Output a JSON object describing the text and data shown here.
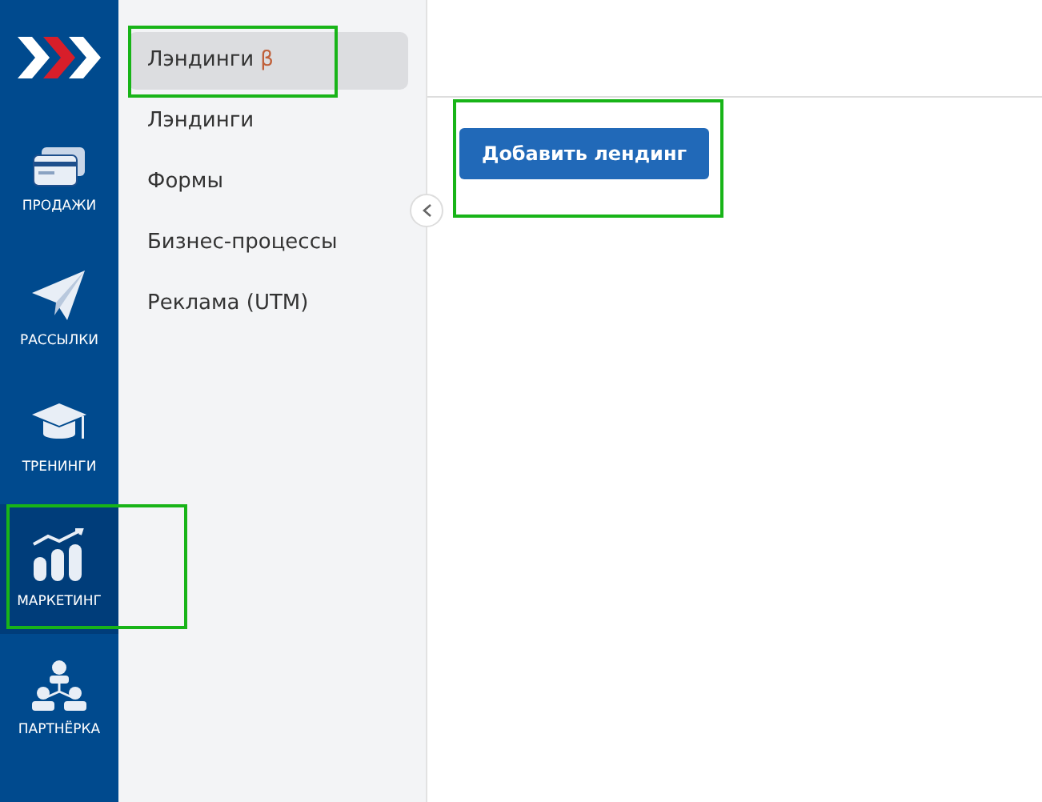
{
  "rail": {
    "items": [
      {
        "kind": "card",
        "label": "ПРОДАЖИ",
        "selected": false,
        "highlighted": false
      },
      {
        "kind": "plane",
        "label": "РАССЫЛКИ",
        "selected": false,
        "highlighted": false
      },
      {
        "kind": "cap",
        "label": "ТРЕНИНГИ",
        "selected": false,
        "highlighted": false
      },
      {
        "kind": "chart",
        "label": "МАРКЕТИНГ",
        "selected": true,
        "highlighted": true
      },
      {
        "kind": "people",
        "label": "ПАРТНЁРКА",
        "selected": false,
        "highlighted": false
      }
    ]
  },
  "submenu": {
    "items": [
      {
        "label": "Лэндинги",
        "badge": "β",
        "selected": true,
        "highlighted": true
      },
      {
        "label": "Лэндинги",
        "selected": false,
        "highlighted": false
      },
      {
        "label": "Формы",
        "selected": false,
        "highlighted": false
      },
      {
        "label": "Бизнес-процессы",
        "selected": false,
        "highlighted": false
      },
      {
        "label": "Реклама (UTM)",
        "selected": false,
        "highlighted": false
      }
    ]
  },
  "main": {
    "add_button": {
      "label": "Добавить лендинг",
      "highlighted": true
    }
  }
}
